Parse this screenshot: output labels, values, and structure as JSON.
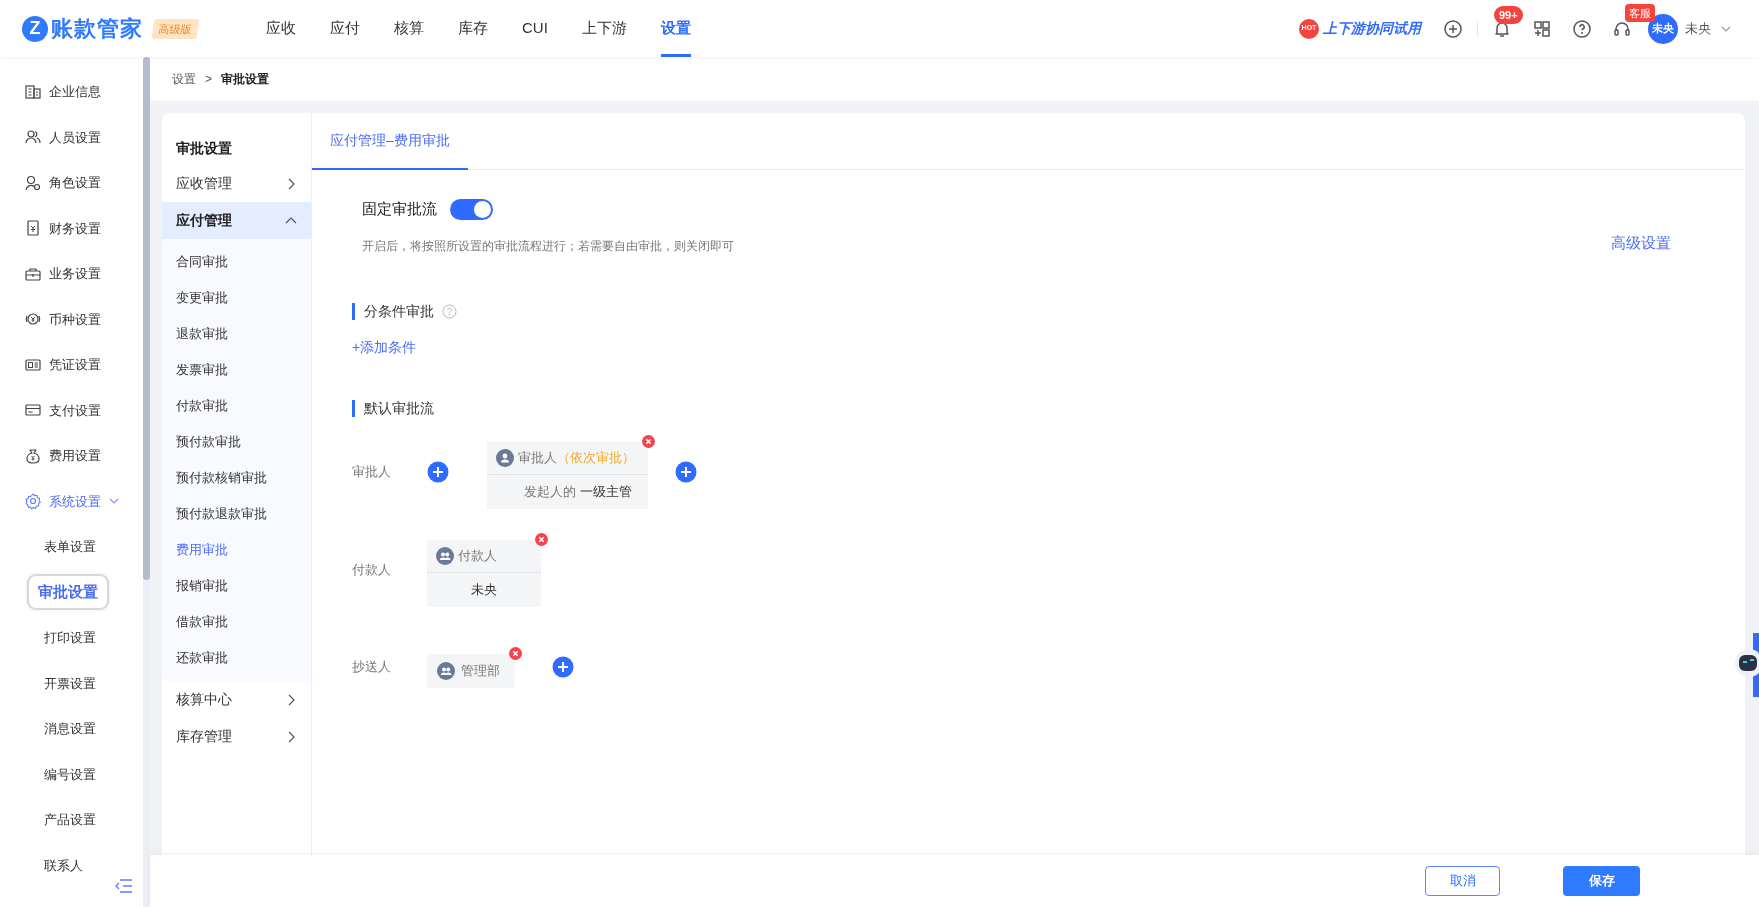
{
  "header": {
    "logo_mark": "Z",
    "logo_text": "账款管家",
    "edition": "高级版",
    "nav": [
      {
        "label": "应收",
        "selected": false
      },
      {
        "label": "应付",
        "selected": false
      },
      {
        "label": "核算",
        "selected": false
      },
      {
        "label": "库存",
        "selected": false
      },
      {
        "label": "CUI",
        "selected": false
      },
      {
        "label": "上下游",
        "selected": false
      },
      {
        "label": "设置",
        "selected": true
      }
    ],
    "promo_badge": "HOT",
    "promo": "上下游协同试用",
    "notification_badge": "99+",
    "support_badge": "客服",
    "avatar_text": "未央",
    "user_name": "未央"
  },
  "sidebar": {
    "items": [
      {
        "label": "企业信息",
        "expanded": false
      },
      {
        "label": "人员设置",
        "expanded": false
      },
      {
        "label": "角色设置",
        "expanded": false
      },
      {
        "label": "财务设置",
        "expanded": false
      },
      {
        "label": "业务设置",
        "expanded": false
      },
      {
        "label": "币种设置",
        "expanded": false
      },
      {
        "label": "凭证设置",
        "expanded": false
      },
      {
        "label": "支付设置",
        "expanded": false
      },
      {
        "label": "费用设置",
        "expanded": false
      },
      {
        "label": "系统设置",
        "expanded": true,
        "children": [
          {
            "label": "表单设置",
            "selected": false
          },
          {
            "label": "审批设置",
            "selected": true
          },
          {
            "label": "打印设置",
            "selected": false
          },
          {
            "label": "开票设置",
            "selected": false
          },
          {
            "label": "消息设置",
            "selected": false
          },
          {
            "label": "编号设置",
            "selected": false
          },
          {
            "label": "产品设置",
            "selected": false
          },
          {
            "label": "联系人",
            "selected": false
          }
        ]
      }
    ]
  },
  "breadcrumb": {
    "items": [
      "设置",
      "审批设置"
    ],
    "separator": ">"
  },
  "approval_menu": {
    "title": "审批设置",
    "groups": [
      {
        "label": "应收管理",
        "expanded": false
      },
      {
        "label": "应付管理",
        "expanded": true,
        "children": [
          {
            "label": "合同审批",
            "selected": false
          },
          {
            "label": "变更审批",
            "selected": false
          },
          {
            "label": "退款审批",
            "selected": false
          },
          {
            "label": "发票审批",
            "selected": false
          },
          {
            "label": "付款审批",
            "selected": false
          },
          {
            "label": "预付款审批",
            "selected": false
          },
          {
            "label": "预付款核销审批",
            "selected": false
          },
          {
            "label": "预付款退款审批",
            "selected": false
          },
          {
            "label": "费用审批",
            "selected": true
          },
          {
            "label": "报销审批",
            "selected": false
          },
          {
            "label": "借款审批",
            "selected": false
          },
          {
            "label": "还款审批",
            "selected": false
          }
        ]
      },
      {
        "label": "核算中心",
        "expanded": false
      },
      {
        "label": "库存管理",
        "expanded": false
      }
    ]
  },
  "tabs": [
    {
      "label": "应付管理–费用审批",
      "selected": true
    }
  ],
  "fixed_flow": {
    "label": "固定审批流",
    "on": true,
    "description": "开启后，将按照所设置的审批流程进行；若需要自由审批，则关闭即可",
    "advanced_link": "高级设置"
  },
  "conditional": {
    "title": "分条件审批",
    "add_link": "+添加条件"
  },
  "default_flow": {
    "title": "默认审批流",
    "rows": [
      {
        "label": "审批人",
        "add_before": true,
        "add_after": true,
        "nodes": [
          {
            "kind": "approver",
            "title": "审批人",
            "note": "（依次审批）",
            "body_prefix": "发起人的",
            "body": "一级主管"
          }
        ]
      },
      {
        "label": "付款人",
        "add_before": false,
        "add_after": false,
        "nodes": [
          {
            "kind": "payer",
            "title": "付款人",
            "body": "未央"
          }
        ]
      },
      {
        "label": "抄送人",
        "add_before": false,
        "add_after": true,
        "nodes": [
          {
            "kind": "recipient",
            "title": "管理部"
          }
        ]
      }
    ]
  },
  "footer": {
    "cancel": "取消",
    "save": "保存"
  }
}
